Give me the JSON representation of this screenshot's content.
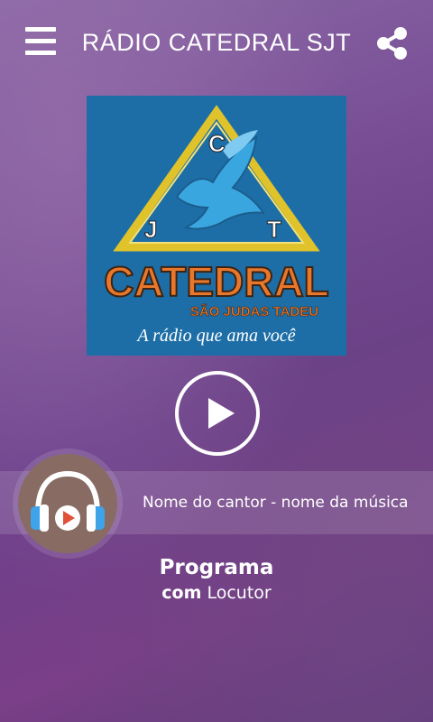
{
  "header": {
    "title": "RÁDIO CATEDRAL SJT",
    "menu_icon": "hamburger-menu-icon",
    "share_icon": "share-icon"
  },
  "logo": {
    "letters": [
      "C",
      "J",
      "T"
    ],
    "brand": "CATEDRAL",
    "subtitle": "SÃO JUDAS TADEU",
    "tagline": "A rádio que ama você",
    "colors": {
      "background": "#1d6ea7",
      "triangle": "#e0c22b",
      "brand": "#e8772b",
      "dove": "#3aa6e0"
    }
  },
  "player": {
    "play_icon": "play-icon",
    "now_playing": "Nome do cantor - nome da música",
    "artwork_icon": "headphones-icon"
  },
  "program": {
    "name": "Programa",
    "host_prefix": "com",
    "host": "Locutor"
  }
}
